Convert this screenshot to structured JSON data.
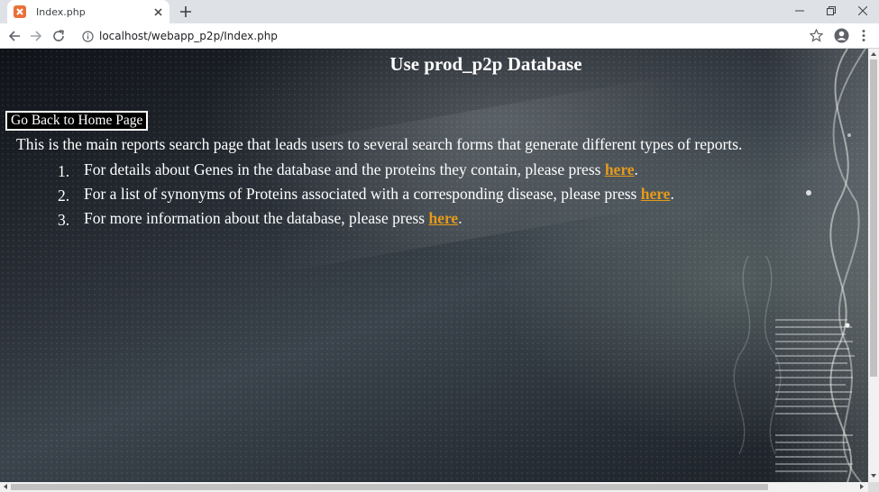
{
  "browser": {
    "tab_title": "Index.php",
    "url": "localhost/webapp_p2p/Index.php",
    "favicon_color": "#e8713a",
    "icons": [
      "close-icon",
      "plus-icon",
      "back-icon",
      "forward-icon",
      "reload-icon",
      "info-icon",
      "star-icon",
      "profile-icon",
      "menu-icon",
      "minimize-icon",
      "restore-icon",
      "window-close-icon"
    ]
  },
  "page": {
    "title": "Use prod_p2p Database",
    "home_button": "Go Back to Home Page",
    "intro": "This is the main reports search page that leads users to several search forms that generate different types of reports.",
    "items": [
      {
        "num": "1.",
        "text": "For details about Genes in the database and the proteins they contain, please press ",
        "link": "here",
        "after": "."
      },
      {
        "num": "2.",
        "text": "For a list of synonyms of Proteins associated with a corresponding disease, please press ",
        "link": "here",
        "after": "."
      },
      {
        "num": "3.",
        "text": "For more information about the database, please press ",
        "link": "here",
        "after": "."
      }
    ],
    "link_color": "#e69a1b"
  }
}
